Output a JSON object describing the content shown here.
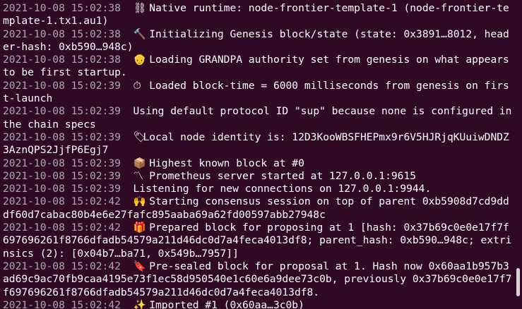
{
  "terminal": {
    "background": "#300a24",
    "timestamp_color": "#aaaaaa",
    "text_color": "#ffffff",
    "lines": [
      {
        "ts": "2021-10-08 15:02:38",
        "icon": "⛓",
        "icon_name": "chain-icon",
        "msg": " Native runtime: node-frontier-template-1 (node-frontier-template-1.tx1.au1)"
      },
      {
        "ts": "2021-10-08 15:02:38",
        "icon": "🔨",
        "icon_name": "hammer-icon",
        "msg": " Initializing Genesis block/state (state: 0x3891…8012, header-hash: 0xb590…948c)"
      },
      {
        "ts": "2021-10-08 15:02:38",
        "icon": "👴",
        "icon_name": "old-man-icon",
        "msg": " Loading GRANDPA authority set from genesis on what appears to be first startup."
      },
      {
        "ts": "2021-10-08 15:02:39",
        "icon": "⏱",
        "icon_name": "stopwatch-icon",
        "msg": " Loaded block-time = 6000 milliseconds from genesis on first-launch"
      },
      {
        "ts": "2021-10-08 15:02:39",
        "icon": "",
        "icon_name": "",
        "msg": "Using default protocol ID \"sup\" because none is configured in the chain specs"
      },
      {
        "ts": "2021-10-08 15:02:39",
        "icon": "🏷",
        "icon_name": "label-icon",
        "msg": "Local node identity is: 12D3KooWBSFHEPmx9r6V5HJRjqKUuiwDNDZ3AznQPS2JjfP6Egj7"
      },
      {
        "ts": "2021-10-08 15:02:39",
        "icon": "📦",
        "icon_name": "package-icon",
        "msg": " Highest known block at #0"
      },
      {
        "ts": "2021-10-08 15:02:39",
        "icon": "〽",
        "icon_name": "part-alternation-mark-icon",
        "msg": " Prometheus server started at 127.0.0.1:9615"
      },
      {
        "ts": "2021-10-08 15:02:39",
        "icon": "",
        "icon_name": "",
        "msg": "Listening for new connections on 127.0.0.1:9944."
      },
      {
        "ts": "2021-10-08 15:02:42",
        "icon": "🙌",
        "icon_name": "raised-hands-icon",
        "msg": " Starting consensus session on top of parent 0xb5908d7cd9dddf60d7cabac80b4e6e27fafc895aaba69a62fd00597abb27948c"
      },
      {
        "ts": "2021-10-08 15:02:42",
        "icon": "🎁",
        "icon_name": "gift-icon",
        "msg": " Prepared block for proposing at 1 [hash: 0x37b69c0e0e17f7f697696261f8766dfadb54579a211d46dc0d7a4feca4013df8; parent_hash: 0xb590…948c; extrinsics (2): [0x04b7…ba71, 0x549b…7957]]"
      },
      {
        "ts": "2021-10-08 15:02:42",
        "icon": "🔖",
        "icon_name": "bookmark-icon",
        "msg": " Pre-sealed block for proposal at 1. Hash now 0x60aa1b957b3ad69c9ac70fb9caa4195e73f1ec58d950540e1c60e6a9dee73c0b, previously 0x37b69c0e0e17f7f697696261f8766dfadb54579a211d46dc0d7a4feca4013df8."
      },
      {
        "ts": "2021-10-08 15:02:42",
        "icon": "✨",
        "icon_name": "sparkles-icon",
        "msg": " Imported #1 (0x60aa…3c0b)"
      }
    ]
  },
  "scrollbar": {
    "thumb_color": "#d6d6d6"
  }
}
